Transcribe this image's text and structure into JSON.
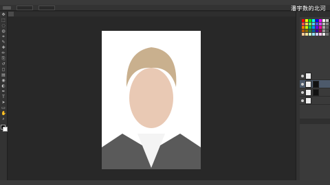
{
  "watermark": {
    "text": "潘宇数的北河"
  },
  "menubar": {
    "items": [
      "",
      "",
      "",
      "",
      "",
      "",
      "",
      "",
      "",
      "",
      ""
    ]
  },
  "tabbar": {
    "active_tab": ""
  },
  "canvas": {
    "description_visible": false
  },
  "status": {
    "text": ""
  },
  "colors": {
    "workspace": "#282828",
    "panel": "#3a3a3a",
    "canvas_bg": "#ffffff",
    "active_layer": "#4d5a6b"
  },
  "toolbar": {
    "icons": [
      "move-icon",
      "marquee-icon",
      "lasso-icon",
      "quick-select-icon",
      "crop-icon",
      "eyedropper-icon",
      "healing-icon",
      "brush-icon",
      "stamp-icon",
      "history-brush-icon",
      "eraser-icon",
      "gradient-icon",
      "blur-icon",
      "dodge-icon",
      "pen-icon",
      "type-icon",
      "path-select-icon",
      "shape-icon",
      "hand-icon",
      "zoom-icon"
    ]
  },
  "swatches": {
    "colors": [
      "#ff0000",
      "#ffff00",
      "#00ff00",
      "#00ffff",
      "#0000ff",
      "#ff00ff",
      "#ffffff",
      "#cccccc",
      "#000000",
      "#ff4d4d",
      "#ffd24d",
      "#66ff66",
      "#4dd2ff",
      "#4d4dff",
      "#d24dff",
      "#bbbbbb",
      "#888888",
      "#333333",
      "#ff8000",
      "#c8ff00",
      "#00c864",
      "#0096ff",
      "#6400ff",
      "#ff0096",
      "#aaaaaa",
      "#666666",
      "#222222",
      "#b35900",
      "#8c6d00",
      "#2d7a2d",
      "#005c99",
      "#3a0099",
      "#99005c",
      "#999999",
      "#555555",
      "#111111",
      "#ffcc99",
      "#ffe699",
      "#ccffcc",
      "#99e6ff",
      "#ccccff",
      "#ffccf2",
      "#f0f0f0",
      "#777777",
      "#444444"
    ]
  },
  "layers": {
    "rows": [
      {
        "name": "",
        "has_mask": false,
        "active": false
      },
      {
        "name": "",
        "has_mask": true,
        "active": true
      },
      {
        "name": "",
        "has_mask": true,
        "active": false
      },
      {
        "name": "",
        "has_mask": false,
        "active": false
      }
    ]
  }
}
